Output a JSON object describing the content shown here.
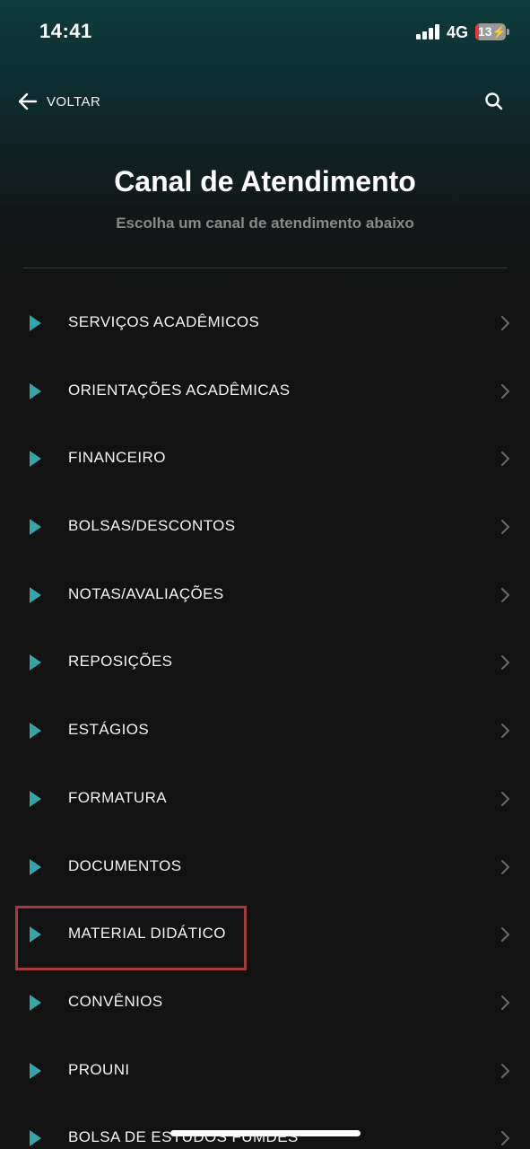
{
  "status_bar": {
    "time": "14:41",
    "network": "4G",
    "battery": "13",
    "battery_level_percent": 13,
    "battery_color": "#e53935"
  },
  "header": {
    "back_label": "VOLTAR",
    "back_icon": "arrow-left-icon",
    "search_icon": "search-icon"
  },
  "page": {
    "title": "Canal de Atendimento",
    "subtitle": "Escolha um canal de atendimento abaixo"
  },
  "menu": {
    "accent_color": "#35a5ab",
    "items": [
      {
        "label": "SERVIÇOS ACADÊMICOS"
      },
      {
        "label": "ORIENTAÇÕES ACADÊMICAS"
      },
      {
        "label": "FINANCEIRO"
      },
      {
        "label": "BOLSAS/DESCONTOS"
      },
      {
        "label": "NOTAS/AVALIAÇÕES"
      },
      {
        "label": "REPOSIÇÕES"
      },
      {
        "label": "ESTÁGIOS"
      },
      {
        "label": "FORMATURA"
      },
      {
        "label": "DOCUMENTOS"
      },
      {
        "label": "MATERIAL DIDÁTICO",
        "highlighted": true
      },
      {
        "label": "CONVÊNIOS"
      },
      {
        "label": "PROUNI"
      },
      {
        "label": "BOLSA DE ESTUDOS FUMDES"
      }
    ]
  }
}
